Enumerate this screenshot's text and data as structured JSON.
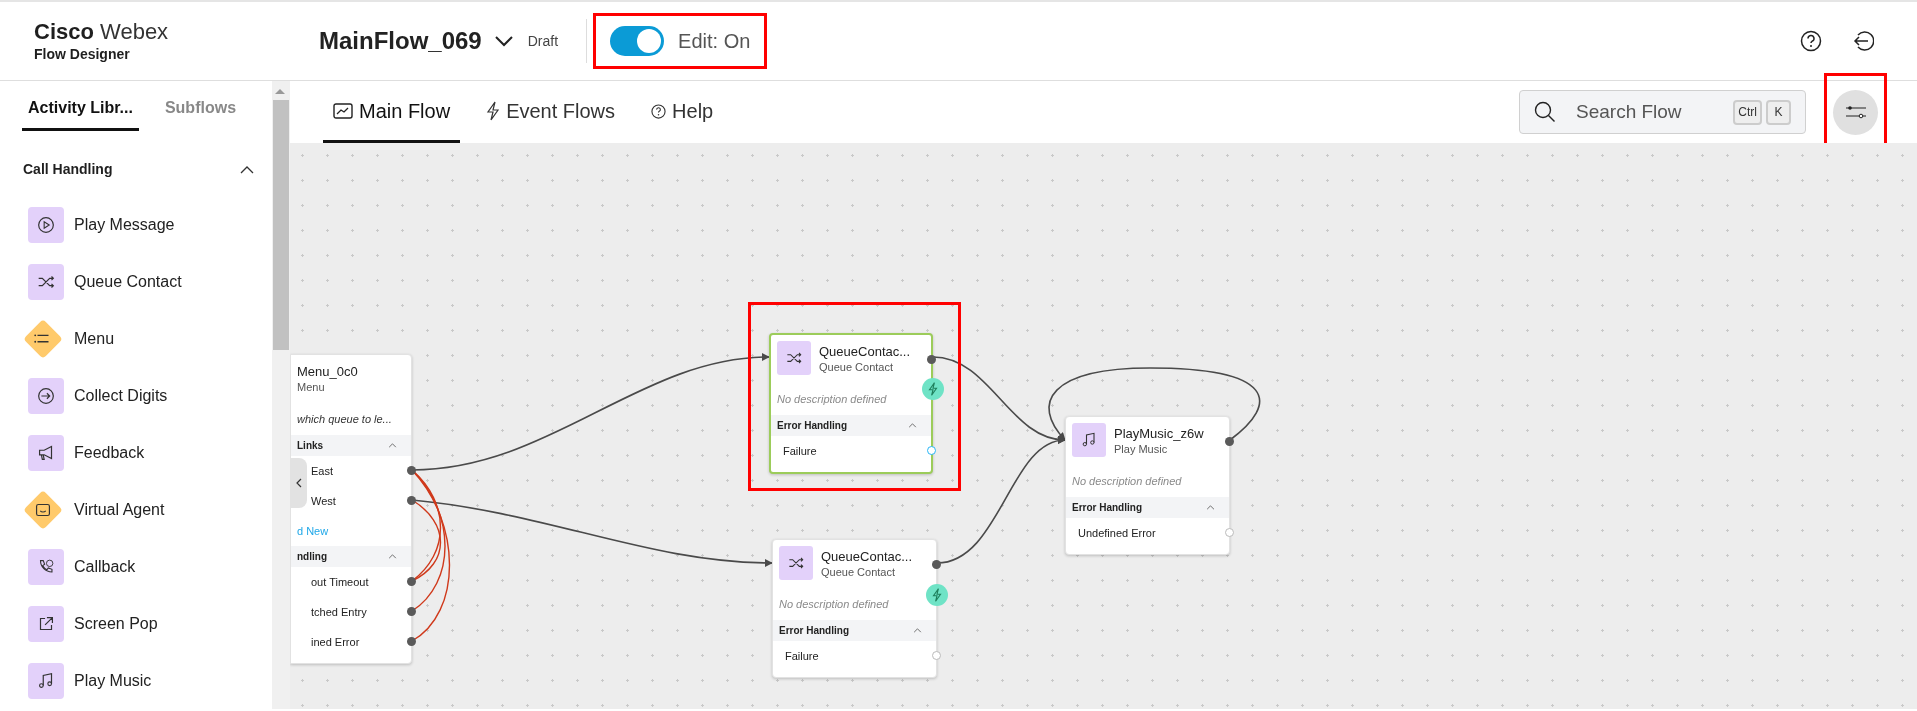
{
  "app": {
    "brand": "Cisco",
    "product": "Webex",
    "subtitle": "Flow Designer"
  },
  "flow": {
    "name": "MainFlow_069",
    "status": "Draft"
  },
  "edit_toggle": {
    "label": "Edit: On",
    "on": true,
    "highlighted": true
  },
  "sidebar": {
    "tabs": [
      {
        "label": "Activity Libr...",
        "selected": true
      },
      {
        "label": "Subflows",
        "selected": false
      }
    ],
    "section": {
      "title": "Call Handling",
      "expanded": true
    },
    "items": [
      {
        "label": "Play Message",
        "kind": "square"
      },
      {
        "label": "Queue Contact",
        "kind": "square"
      },
      {
        "label": "Menu",
        "kind": "diamond"
      },
      {
        "label": "Collect Digits",
        "kind": "square"
      },
      {
        "label": "Feedback",
        "kind": "square"
      },
      {
        "label": "Virtual Agent",
        "kind": "diamond"
      },
      {
        "label": "Callback",
        "kind": "square"
      },
      {
        "label": "Screen Pop",
        "kind": "square"
      },
      {
        "label": "Play Music",
        "kind": "square"
      }
    ]
  },
  "flow_tabs": [
    {
      "label": "Main Flow",
      "selected": true
    },
    {
      "label": "Event Flows",
      "selected": false
    },
    {
      "label": "Help",
      "selected": false
    }
  ],
  "search": {
    "placeholder": "Search Flow",
    "keys": [
      "Ctrl",
      "K"
    ]
  },
  "settings_button": {
    "highlighted": true
  },
  "canvas": {
    "nodes": [
      {
        "kind": "menu",
        "title": "Menu_0c0",
        "type": "Menu",
        "description": "which queue to le...",
        "selected": false,
        "sections": [
          {
            "title": "Links",
            "expanded": true,
            "rows": [
              "East",
              "West"
            ],
            "add_link": "d New"
          },
          {
            "title": "ndling",
            "expanded": true,
            "rows": [
              "out Timeout",
              "tched Entry",
              "ined Error"
            ]
          }
        ]
      },
      {
        "kind": "activity",
        "title": "QueueContac...",
        "type": "Queue Contact",
        "description": "No description defined",
        "event_badge": true,
        "selected": true,
        "highlighted": true,
        "sections": [
          {
            "title": "Error Handling",
            "expanded": true,
            "rows": [
              "Failure"
            ]
          }
        ]
      },
      {
        "kind": "activity",
        "title": "QueueContac...",
        "type": "Queue Contact",
        "description": "No description defined",
        "event_badge": true,
        "selected": false,
        "sections": [
          {
            "title": "Error Handling",
            "expanded": true,
            "rows": [
              "Failure"
            ]
          }
        ]
      },
      {
        "kind": "music",
        "title": "PlayMusic_z6w",
        "type": "Play Music",
        "description": "No description defined",
        "selected": false,
        "sections": [
          {
            "title": "Error Handling",
            "expanded": true,
            "rows": [
              "Undefined Error"
            ]
          }
        ]
      }
    ]
  }
}
